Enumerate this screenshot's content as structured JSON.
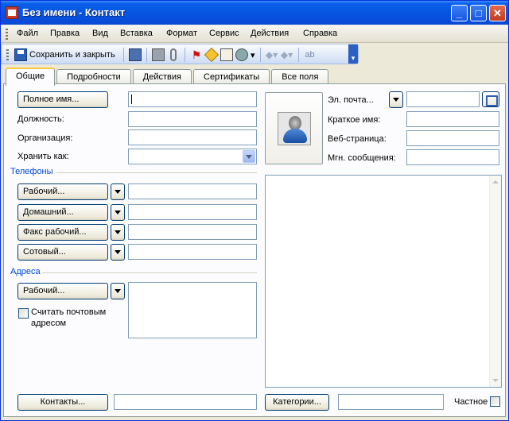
{
  "window": {
    "title": "Без имени - Контакт"
  },
  "menu": [
    "Файл",
    "Правка",
    "Вид",
    "Вставка",
    "Формат",
    "Сервис",
    "Действия",
    "Справка"
  ],
  "toolbar": {
    "save_close_label": "Сохранить и закрыть"
  },
  "tabs": [
    "Общие",
    "Подробности",
    "Действия",
    "Сертификаты",
    "Все поля"
  ],
  "general": {
    "full_name_button": "Полное имя...",
    "job_title_label": "Должность:",
    "company_label": "Организация:",
    "file_as_label": "Хранить как:",
    "phones_section": "Телефоны",
    "phone_buttons": [
      "Рабочий...",
      "Домашний...",
      "Факс рабочий...",
      "Сотовый..."
    ],
    "address_section": "Адреса",
    "address_button": "Рабочий...",
    "mailing_address_label_1": "Считать почтовым",
    "mailing_address_label_2": "адресом",
    "email_label": "Эл. почта...",
    "display_as_label": "Краткое имя:",
    "web_label": "Веб-страница:",
    "im_label": "Мгн. сообщения:",
    "contacts_button": "Контакты...",
    "categories_button": "Категории...",
    "private_label": "Частное"
  },
  "colors": {
    "title_bar": "#0653e0",
    "section_heading": "#0046d5",
    "active_tab_accent": "#ffc83c"
  }
}
